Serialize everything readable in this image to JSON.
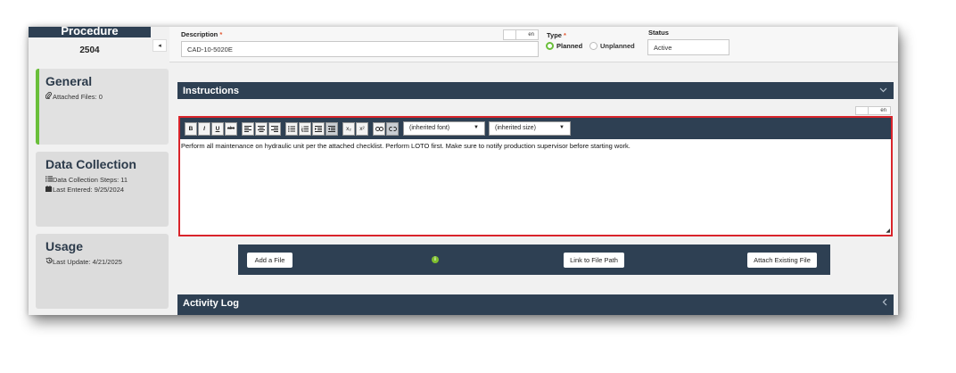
{
  "sidebar": {
    "procedure_title": "Procedure",
    "procedure_number": "2504",
    "collapse_icon": "◂",
    "cards": [
      {
        "title": "General",
        "lines": [
          {
            "icon": "paperclip-icon",
            "text": "Attached Files: 0"
          }
        ]
      },
      {
        "title": "Data Collection",
        "lines": [
          {
            "icon": "list-icon",
            "text": "Data Collection Steps: 11"
          },
          {
            "icon": "calendar-icon",
            "text": "Last Entered: 9/25/2024"
          }
        ]
      },
      {
        "title": "Usage",
        "lines": [
          {
            "icon": "history-icon",
            "text": "Last Update: 4/21/2025"
          }
        ]
      }
    ],
    "active_accent": "#6abf3a"
  },
  "header": {
    "description_label": "Description",
    "required_mark": "*",
    "description_value": "CAD-10-5020E",
    "lang_code": "en",
    "type_label": "Type",
    "type_options": [
      "Planned",
      "Unplanned"
    ],
    "type_selected": "Planned",
    "status_label": "Status",
    "status_value": "Active"
  },
  "instructions": {
    "title": "Instructions",
    "lang_code": "en",
    "font_select": "(inherited font)",
    "size_select": "(inherited size)",
    "body_text": "Perform all maintenance on hydraulic unit per the attached checklist.  Perform LOTO first.  Make sure to notify production supervisor before starting work.",
    "toolbar_glyphs": {
      "bold": "B",
      "italic": "I",
      "underline": "U",
      "strike": "abc",
      "subscript": "x₂",
      "superscript": "x²"
    }
  },
  "attachments": {
    "add_file": "Add a File",
    "link_path": "Link to File Path",
    "attach_existing": "Attach Existing File",
    "info_glyph": "i"
  },
  "activity_log": {
    "title": "Activity Log"
  },
  "colors": {
    "navy": "#2e4053",
    "green": "#6abf3a",
    "highlight_red": "#d9242b",
    "required": "#e2562f"
  }
}
